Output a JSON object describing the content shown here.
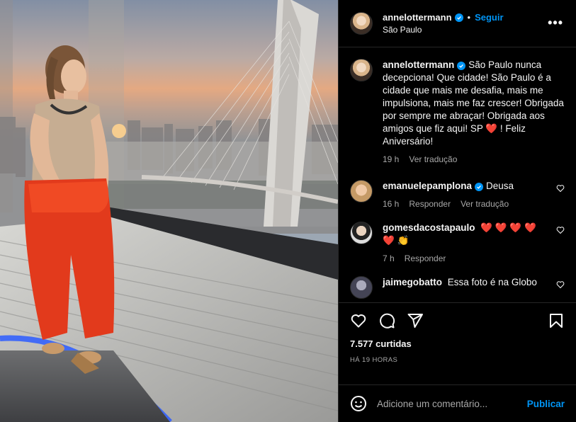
{
  "post": {
    "photo_alt": "",
    "header": {
      "username": "annelottermann",
      "follow_label": "Seguir",
      "location": "São Paulo",
      "more_label": "•••"
    },
    "caption": {
      "username": "annelottermann",
      "text": "São Paulo nunca decepciona! Que cidade! São Paulo é a cidade que mais me desafia, mais me impulsiona, mais me faz crescer! Obrigada por sempre me abraçar! Obrigada aos amigos que fiz aqui! SP ❤️ ! Feliz Aniversário!",
      "age": "19 h",
      "translate": "Ver tradução"
    },
    "comments": [
      {
        "username": "emanuelepamplona",
        "verified": true,
        "text": "Deusa",
        "age": "16 h",
        "reply": "Responder",
        "translate": "Ver tradução"
      },
      {
        "username": "gomesdacostapaulo",
        "verified": false,
        "text": "❤️ ❤️ ❤️ ❤️ ❤️ 👏",
        "age": "7 h",
        "reply": "Responder",
        "translate": ""
      },
      {
        "username": "jaimegobatto",
        "verified": false,
        "text": "Essa foto é na Globo",
        "age": "",
        "reply": "",
        "translate": ""
      }
    ],
    "likes": "7.577 curtidas",
    "posted": "HÁ 19 HORAS",
    "add_comment": {
      "placeholder": "Adicione um comentário...",
      "publish_label": "Publicar"
    }
  },
  "colors": {
    "accent": "#0095f6",
    "background": "#000000",
    "muted": "#a8a8a8",
    "divider": "#262626"
  },
  "icons": {
    "verified": "verified-badge-icon",
    "like": "heart-icon",
    "comment": "comment-bubble-icon",
    "share": "paper-plane-icon",
    "save": "bookmark-icon",
    "emoji": "smiley-icon",
    "more": "more-options-icon"
  }
}
